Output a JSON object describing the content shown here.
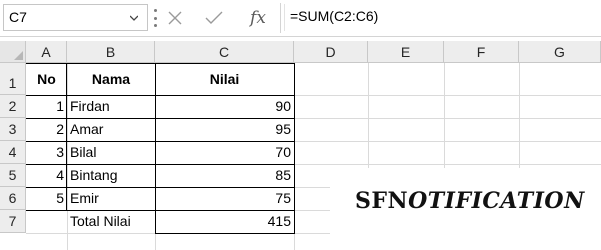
{
  "formula_bar": {
    "name_box": "C7",
    "fx_label": "fx",
    "formula": "=SUM(C2:C6)"
  },
  "columns": [
    "A",
    "B",
    "C",
    "D",
    "E",
    "F",
    "G"
  ],
  "rows": [
    "1",
    "2",
    "3",
    "4",
    "5",
    "6",
    "7"
  ],
  "table": {
    "headers": {
      "no": "No",
      "nama": "Nama",
      "nilai": "Nilai"
    },
    "data": [
      {
        "no": "1",
        "nama": "Firdan",
        "nilai": "90"
      },
      {
        "no": "2",
        "nama": "Amar",
        "nilai": "95"
      },
      {
        "no": "3",
        "nama": "Bilal",
        "nilai": "70"
      },
      {
        "no": "4",
        "nama": "Bintang",
        "nilai": "85"
      },
      {
        "no": "5",
        "nama": "Emir",
        "nilai": "75"
      }
    ],
    "total_label": "Total Nilai",
    "total_value": "415"
  },
  "watermark": {
    "prefix": "SFN",
    "rest": "OTIFICATION"
  },
  "colors": {
    "grid_line": "#dadada",
    "header_bg": "#ededed",
    "border": "#000000"
  }
}
